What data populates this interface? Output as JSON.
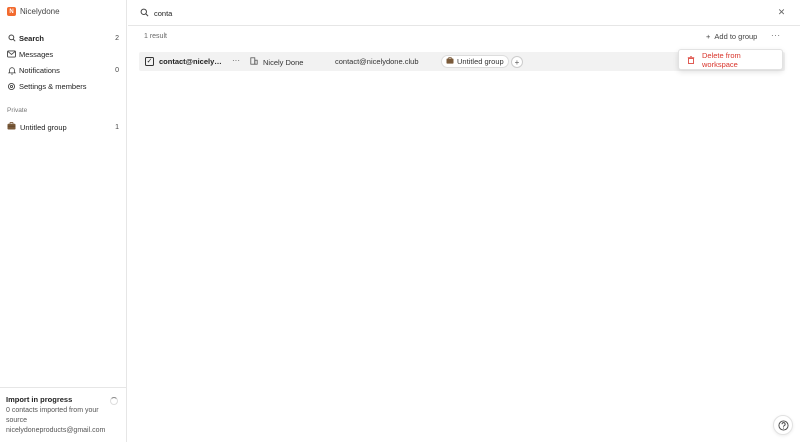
{
  "brand": {
    "name": "Nicelydone",
    "logo_letter": "N",
    "accent": "#f26a2e"
  },
  "nav": {
    "items": [
      {
        "label": "Search",
        "count": "2",
        "icon": "search-icon"
      },
      {
        "label": "Messages",
        "count": "",
        "icon": "mail-icon"
      },
      {
        "label": "Notifications",
        "count": "0",
        "icon": "bell-icon"
      },
      {
        "label": "Settings & members",
        "count": "",
        "icon": "gear-icon"
      }
    ]
  },
  "sidebar": {
    "section_label": "Private",
    "group": {
      "label": "Untitled group",
      "count": "1",
      "icon": "briefcase-icon"
    },
    "import": {
      "title": "Import in progress",
      "text": "0 contacts imported from your source nicelydoneproducts@gmail.com"
    }
  },
  "search": {
    "value": "conta"
  },
  "results": {
    "count_text": "1 result"
  },
  "toolbar": {
    "add_to_group": "Add to group"
  },
  "row": {
    "email_strong": "contact@nicelydone.club",
    "company": "Nicely Done",
    "email": "contact@nicelydone.club",
    "group_tag": "Untitled group"
  },
  "menu": {
    "delete_label": "Delete from workspace",
    "danger_color": "#d9342b"
  }
}
